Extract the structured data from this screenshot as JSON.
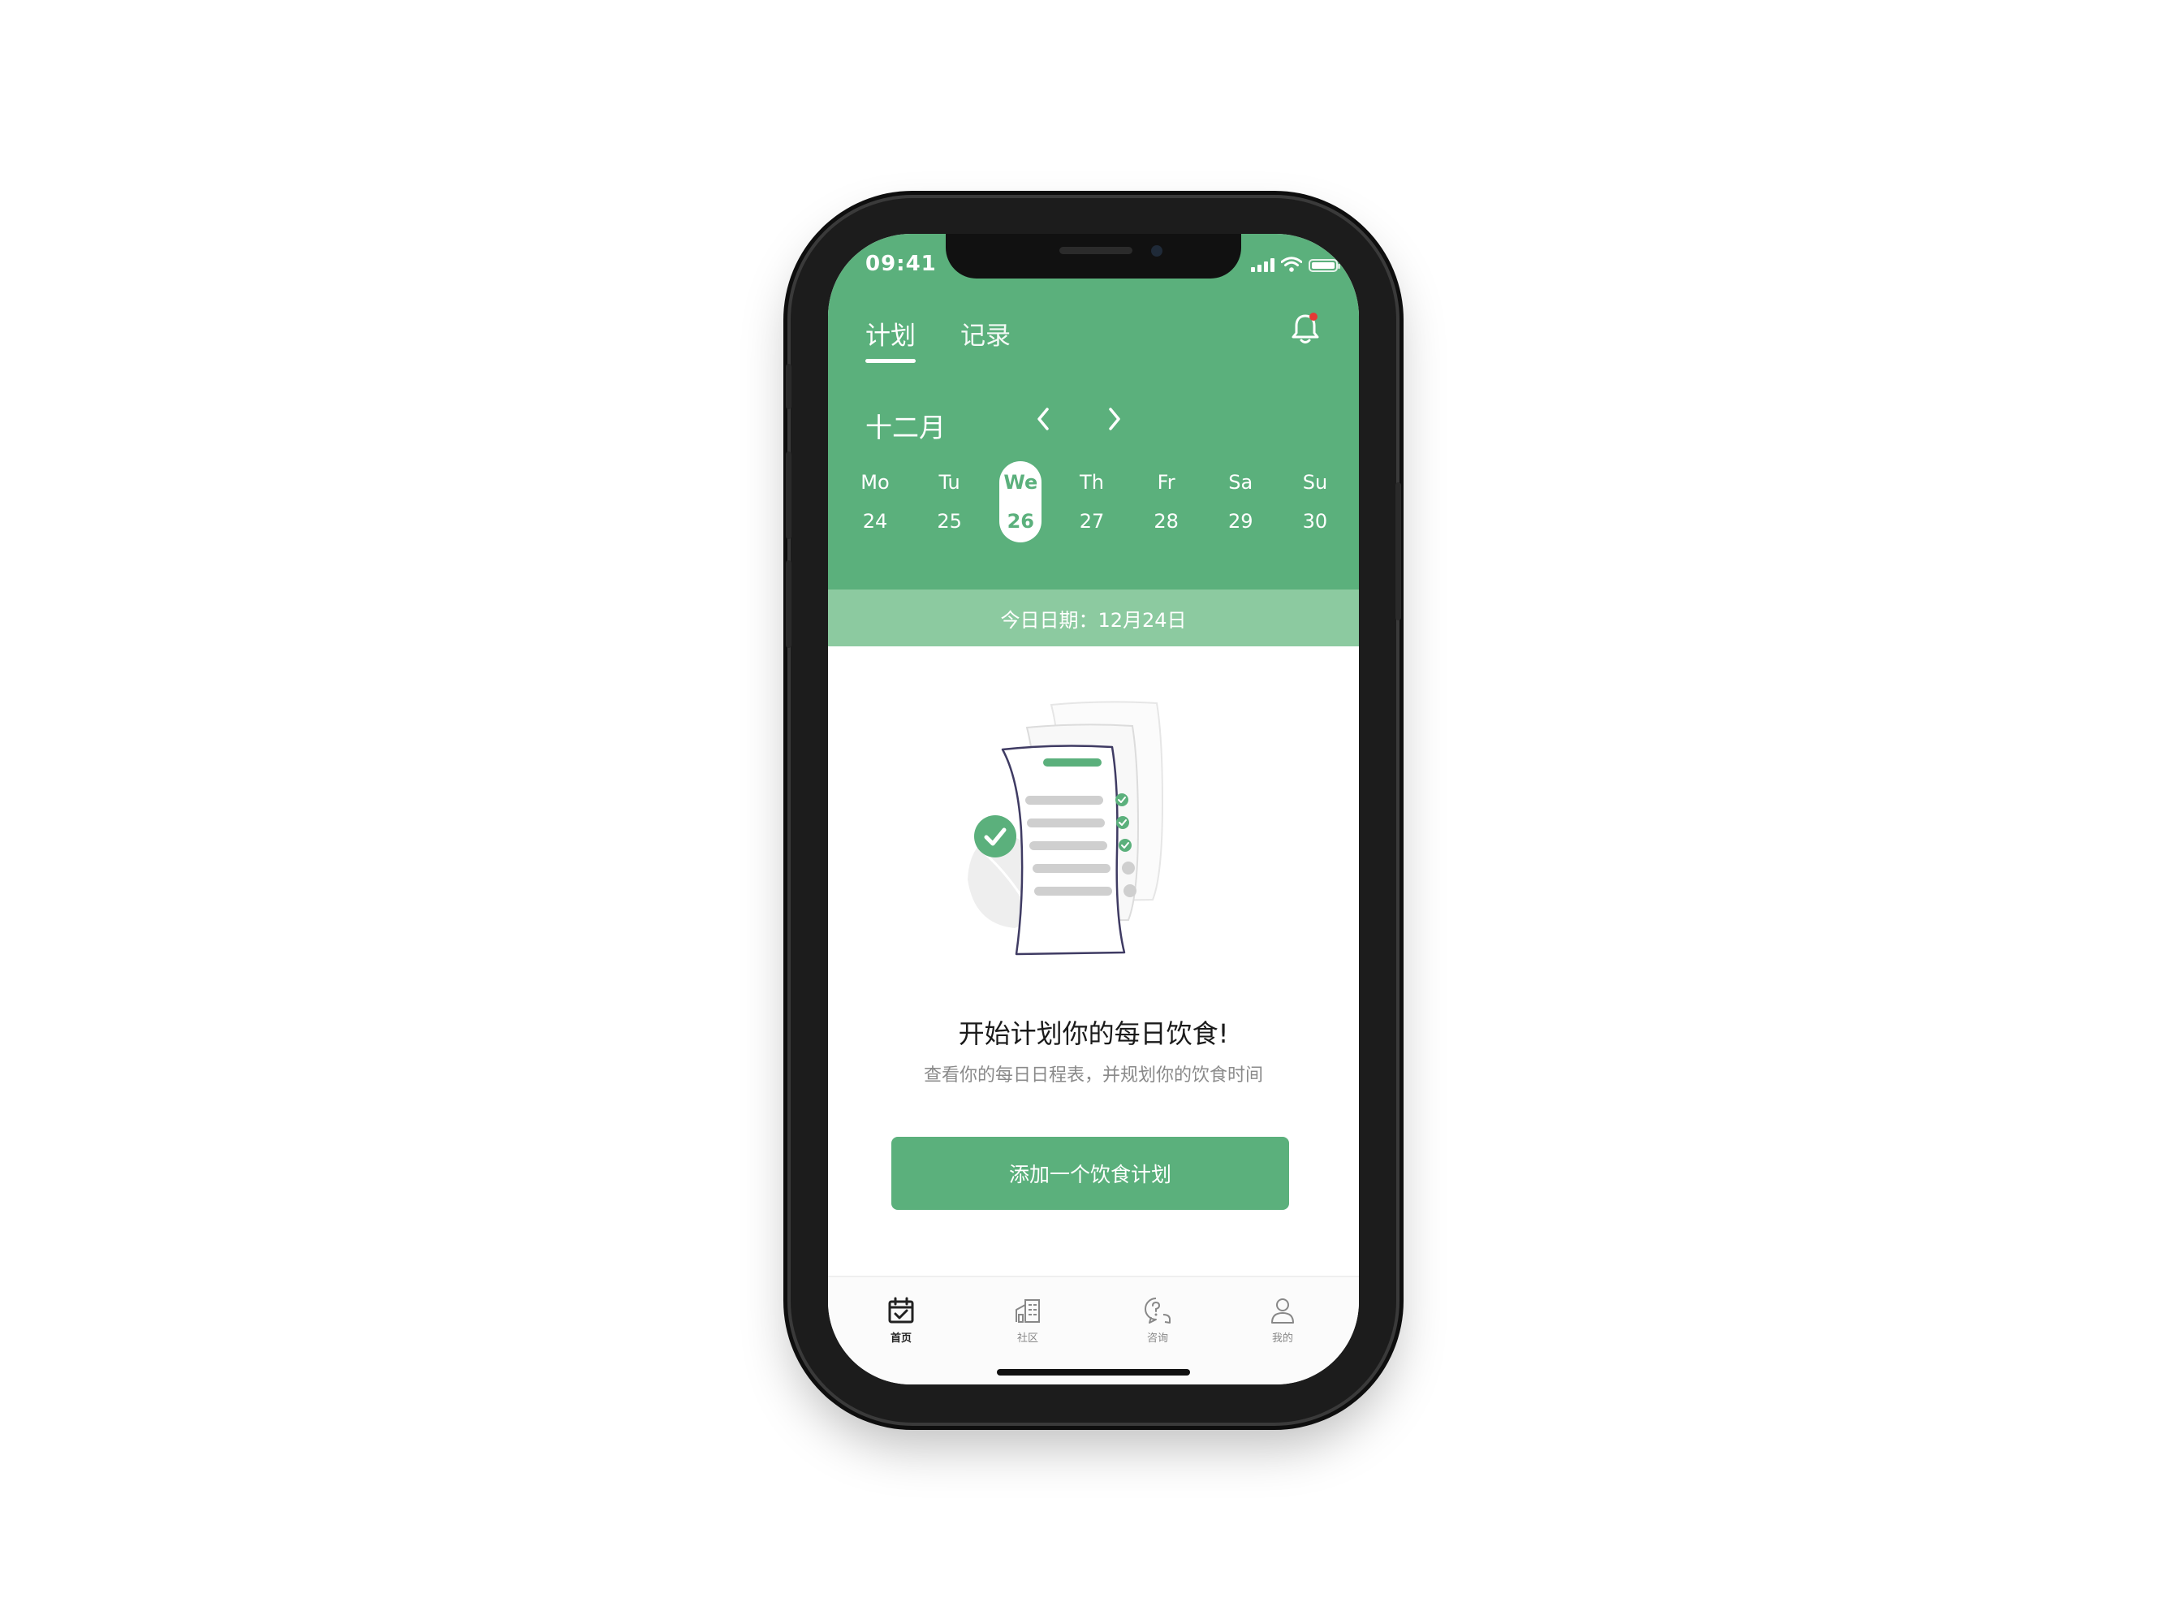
{
  "status_bar": {
    "time": "09:41"
  },
  "header": {
    "tabs": [
      {
        "label": "计划",
        "active": true
      },
      {
        "label": "记录",
        "active": false
      }
    ],
    "bell_icon": "bell-icon",
    "notification_dot_color": "#e53935"
  },
  "calendar": {
    "month": "十二月",
    "prev_icon": "chevron-left-icon",
    "next_icon": "chevron-right-icon",
    "days": [
      {
        "name": "Mo",
        "num": "24",
        "selected": false
      },
      {
        "name": "Tu",
        "num": "25",
        "selected": false
      },
      {
        "name": "We",
        "num": "26",
        "selected": true
      },
      {
        "name": "Th",
        "num": "27",
        "selected": false
      },
      {
        "name": "Fr",
        "num": "28",
        "selected": false
      },
      {
        "name": "Sa",
        "num": "29",
        "selected": false
      },
      {
        "name": "Su",
        "num": "30",
        "selected": false
      }
    ]
  },
  "today_bar": {
    "text": "今日日期：12月24日"
  },
  "empty_state": {
    "illustration": "checklist-document-illustration",
    "title": "开始计划你的每日饮食!",
    "subtitle": "查看你的每日日程表，并规划你的饮食时间",
    "button_label": "添加一个饮食计划"
  },
  "tabbar": {
    "items": [
      {
        "label": "首页",
        "icon": "calendar-check-icon",
        "active": true
      },
      {
        "label": "社区",
        "icon": "building-icon",
        "active": false
      },
      {
        "label": "咨询",
        "icon": "question-chat-icon",
        "active": false
      },
      {
        "label": "我的",
        "icon": "user-icon",
        "active": false
      }
    ]
  },
  "colors": {
    "primary": "#5bb07c",
    "primary_light": "#8ccaa0",
    "text_dark": "#1a1a1a",
    "text_muted": "#8a8a8a"
  }
}
